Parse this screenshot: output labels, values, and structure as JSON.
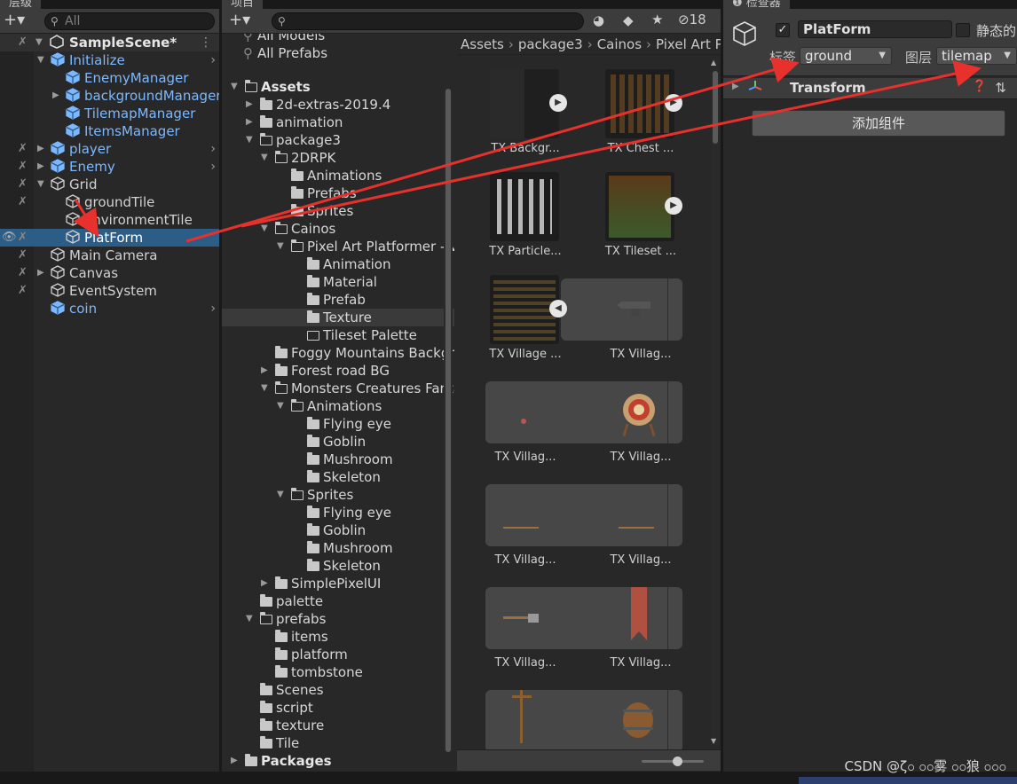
{
  "hierarchy": {
    "tab": "层级",
    "search_placeholder": "All",
    "scene": "SampleScene*",
    "items": [
      {
        "label": "Initialize",
        "style": "blue"
      },
      {
        "label": "EnemyManager",
        "style": "blue"
      },
      {
        "label": "backgroundManager",
        "style": "blue"
      },
      {
        "label": "TilemapManager",
        "style": "blue"
      },
      {
        "label": "ItemsManager",
        "style": "blue"
      },
      {
        "label": "player",
        "style": "blue"
      },
      {
        "label": "Enemy",
        "style": "blue"
      },
      {
        "label": "Grid",
        "style": "normal"
      },
      {
        "label": "groundTile",
        "style": "normal"
      },
      {
        "label": "environmentTile",
        "style": "normal"
      },
      {
        "label": "PlatForm",
        "style": "selected"
      },
      {
        "label": "Main Camera",
        "style": "normal"
      },
      {
        "label": "Canvas",
        "style": "normal"
      },
      {
        "label": "EventSystem",
        "style": "normal"
      },
      {
        "label": "coin",
        "style": "blue"
      }
    ]
  },
  "project": {
    "tab": "项目",
    "hidden_count": "18",
    "favorites": [
      "All Models",
      "All Prefabs"
    ],
    "tree": [
      "Assets",
      "2d-extras-2019.4",
      "animation",
      "package3",
      "2DRPK",
      "Animations",
      "Prefabs",
      "Sprites",
      "Cainos",
      "Pixel Art Platformer - Village Props",
      "Animation",
      "Material",
      "Prefab",
      "Texture",
      "Tileset Palette",
      "Foggy Mountains Background",
      "Forest road BG",
      "Monsters Creatures Fantasy",
      "Animations",
      "Flying eye",
      "Goblin",
      "Mushroom",
      "Skeleton",
      "Sprites",
      "Flying eye",
      "Goblin",
      "Mushroom",
      "Skeleton",
      "SimplePixelUI",
      "palette",
      "prefabs",
      "items",
      "platform",
      "tombstone",
      "Scenes",
      "script",
      "texture",
      "Tile",
      "Packages"
    ],
    "breadcrumb": [
      "Assets",
      "package3",
      "Cainos",
      "Pixel Art Platformer - Village Props"
    ],
    "assets": [
      "TX Backgr...",
      "TX Chest ...",
      "TX Particle...",
      "TX Tileset ...",
      "TX Village ...",
      "TX Villag...",
      "TX Villag...",
      "TX Villag...",
      "TX Villag...",
      "TX Villag...",
      "TX Villag...",
      "TX Villag..."
    ]
  },
  "inspector": {
    "tab": "检查器",
    "object_name": "PlatForm",
    "static_label": "静态的",
    "tag_label": "标签",
    "tag_value": "ground",
    "layer_label": "图层",
    "layer_value": "tilemap",
    "component": "Transform",
    "add_component": "添加组件"
  },
  "watermark": "CSDN @ζ၀ ၀၀雾 ၀၀狼 ၀၀၀",
  "colors": {
    "accent": "#2c5d87",
    "link": "#7cb8ff",
    "arrow": "#e8302c"
  }
}
